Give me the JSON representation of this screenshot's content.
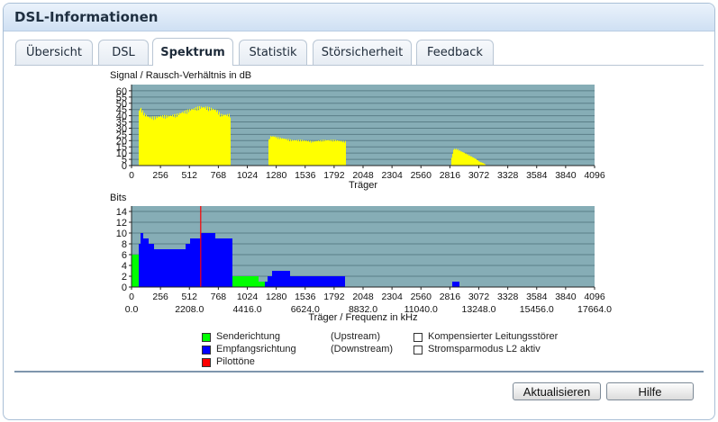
{
  "window": {
    "title": "DSL-Informationen"
  },
  "tabs": [
    {
      "label": "Übersicht",
      "active": false
    },
    {
      "label": "DSL",
      "active": false
    },
    {
      "label": "Spektrum",
      "active": true
    },
    {
      "label": "Statistik",
      "active": false
    },
    {
      "label": "Störsicherheit",
      "active": false
    },
    {
      "label": "Feedback",
      "active": false
    }
  ],
  "chart_data": [
    {
      "type": "bar",
      "title": "Signal / Rausch-Verhältnis in dB",
      "xlabel": "Träger",
      "ylabel": "Signal / Rausch-Verhältnis in dB",
      "xlim": [
        0,
        4096
      ],
      "ylim": [
        0,
        65
      ],
      "yticks": [
        0,
        5,
        10,
        15,
        20,
        25,
        30,
        35,
        40,
        45,
        50,
        55,
        60
      ],
      "xticks": [
        "0",
        "256",
        "512",
        "768",
        "1024",
        "1280",
        "1536",
        "1792",
        "2048",
        "2304",
        "2560",
        "2816",
        "3072",
        "3328",
        "3584",
        "3840",
        "4096"
      ],
      "background": "#86adb6",
      "bar_color": "#ffff00",
      "grid": true,
      "series": [
        {
          "color": "#ffff00",
          "profile": [
            [
              64,
              40
            ],
            [
              72,
              46
            ],
            [
              90,
              44
            ],
            [
              120,
              40
            ],
            [
              160,
              38
            ],
            [
              210,
              38
            ],
            [
              260,
              39
            ],
            [
              320,
              39
            ],
            [
              400,
              40
            ],
            [
              450,
              42
            ],
            [
              520,
              44
            ],
            [
              600,
              46
            ],
            [
              650,
              46
            ],
            [
              700,
              45
            ],
            [
              740,
              44
            ],
            [
              760,
              43
            ],
            [
              790,
              40
            ],
            [
              880,
              40
            ]
          ]
        },
        {
          "color": "#ffff00",
          "profile": [
            [
              1210,
              19
            ],
            [
              1230,
              23
            ],
            [
              1260,
              23
            ],
            [
              1300,
              22
            ],
            [
              1360,
              21
            ],
            [
              1420,
              20
            ],
            [
              1500,
              20
            ],
            [
              1600,
              19
            ],
            [
              1700,
              20
            ],
            [
              1800,
              20
            ],
            [
              1880,
              19
            ],
            [
              1900,
              19
            ]
          ]
        },
        {
          "color": "#ffff00",
          "profile": [
            [
              2830,
              5
            ],
            [
              2850,
              13
            ],
            [
              2880,
              13
            ],
            [
              2920,
              11
            ],
            [
              2970,
              9
            ],
            [
              3010,
              7
            ],
            [
              3050,
              5
            ],
            [
              3080,
              3
            ],
            [
              3110,
              2
            ],
            [
              3130,
              1
            ]
          ]
        }
      ]
    },
    {
      "type": "bar",
      "title": "Bits",
      "xlabel": "Träger / Frequenz in kHz",
      "ylabel": "Bits",
      "xlim": [
        0,
        4096
      ],
      "ylim": [
        0,
        15
      ],
      "yticks": [
        0,
        2,
        4,
        6,
        8,
        10,
        12,
        14
      ],
      "xticks": [
        "0",
        "256",
        "512",
        "768",
        "1024",
        "1280",
        "1536",
        "1792",
        "2048",
        "2304",
        "2560",
        "2816",
        "3072",
        "3328",
        "3584",
        "3840",
        "4096"
      ],
      "freq_ticks": [
        "0.0",
        "2208.0",
        "4416.0",
        "6624.0",
        "8832.0",
        "11040.0",
        "13248.0",
        "15456.0",
        "17664.0"
      ],
      "background": "#86adb6",
      "grid": true,
      "pilot_carrier": 612,
      "series": [
        {
          "name": "Senderichtung",
          "color": "#00ff00",
          "segments": [
            [
              0,
              6
            ],
            [
              40,
              6
            ],
            [
              60,
              2
            ],
            [
              890,
              2
            ],
            [
              1040,
              2
            ],
            [
              1120,
              1
            ],
            [
              1180,
              1
            ]
          ]
        },
        {
          "name": "Empfangsrichtung",
          "color": "#0000ff",
          "segments": [
            [
              64,
              8
            ],
            [
              80,
              10
            ],
            [
              100,
              9
            ],
            [
              130,
              9
            ],
            [
              150,
              8
            ],
            [
              180,
              8
            ],
            [
              200,
              7
            ],
            [
              250,
              7
            ],
            [
              320,
              7
            ],
            [
              400,
              7
            ],
            [
              480,
              8
            ],
            [
              520,
              9
            ],
            [
              560,
              9
            ],
            [
              612,
              10
            ],
            [
              650,
              10
            ],
            [
              700,
              10
            ],
            [
              740,
              9
            ],
            [
              780,
              9
            ],
            [
              820,
              9
            ],
            [
              880,
              9
            ]
          ]
        },
        {
          "name": "Empfangsrichtung",
          "color": "#0000ff",
          "segments": [
            [
              1180,
              1
            ],
            [
              1200,
              2
            ],
            [
              1240,
              3
            ],
            [
              1400,
              2
            ],
            [
              1500,
              2
            ],
            [
              1700,
              2
            ],
            [
              1880,
              2
            ]
          ]
        },
        {
          "name": "Empfangsrichtung",
          "color": "#0000ff",
          "segments": [
            [
              2840,
              1
            ],
            [
              2890,
              1
            ]
          ]
        }
      ]
    }
  ],
  "legend": {
    "items": [
      {
        "label": "Senderichtung",
        "direction": "(Upstream)",
        "color": "#00ff00"
      },
      {
        "label": "Empfangsrichtung",
        "direction": "(Downstream)",
        "color": "#0000ff"
      },
      {
        "label": "Pilottöne",
        "direction": "",
        "color": "#ff0000"
      }
    ],
    "extra": [
      {
        "label": "Kompensierter Leitungsstörer",
        "color": "#ffffff"
      },
      {
        "label": "Stromsparmodus L2 aktiv",
        "color": "#ffffff"
      }
    ]
  },
  "buttons": {
    "refresh": "Aktualisieren",
    "help": "Hilfe"
  }
}
